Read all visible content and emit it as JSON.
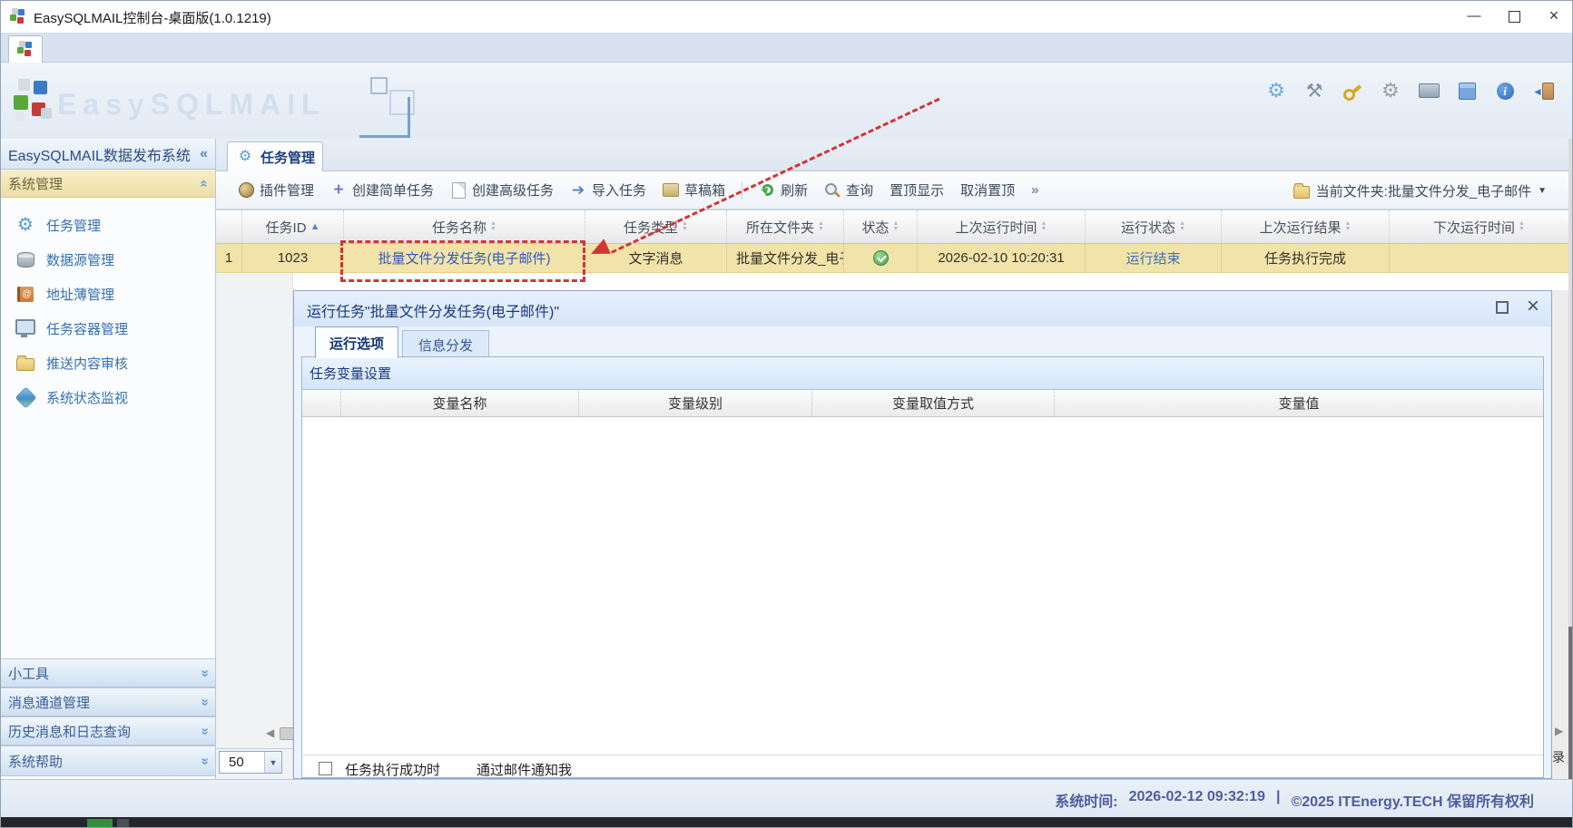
{
  "titlebar": {
    "title": "EasySQLMAIL控制台-桌面版(1.0.1219)",
    "minimize_glyph": "—",
    "close_glyph": "×"
  },
  "banner": {
    "watermark": "EasySQLMAIL"
  },
  "header_icons": [
    {
      "name": "settings-gear-icon"
    },
    {
      "name": "tools-icon"
    },
    {
      "name": "key-icon"
    },
    {
      "name": "service-gear-icon"
    },
    {
      "name": "drive-icon"
    },
    {
      "name": "cube-icon"
    },
    {
      "name": "info-icon"
    },
    {
      "name": "exit-icon"
    }
  ],
  "glyphs": {
    "collapse_left": "«",
    "chevron": "«",
    "overflow": "»",
    "dropdown": "▼",
    "sort_asc": "▲",
    "left_arrow": "◀",
    "right_arrow": "▶",
    "select_arrow": "▼",
    "exit_arrow": "◄",
    "info_i": "i",
    "gear": "⚙",
    "tools": "⚒"
  },
  "sidebar": {
    "header": "EasySQLMAIL数据发布系统",
    "section": "系统管理",
    "items": [
      {
        "label": "任务管理",
        "icon": "gear-icon"
      },
      {
        "label": "数据源管理",
        "icon": "database-icon"
      },
      {
        "label": "地址薄管理",
        "icon": "address-book-icon"
      },
      {
        "label": "任务容器管理",
        "icon": "monitor-icon"
      },
      {
        "label": "推送内容审核",
        "icon": "folder-icon"
      },
      {
        "label": "系统状态监视",
        "icon": "globe-icon"
      }
    ],
    "bottom_sections": [
      {
        "label": "小工具"
      },
      {
        "label": "消息通道管理"
      },
      {
        "label": "历史消息和日志查询"
      },
      {
        "label": "系统帮助"
      }
    ]
  },
  "main": {
    "tab_label": "任务管理",
    "toolbar": {
      "plugin": "插件管理",
      "create_simple": "创建简单任务",
      "create_advanced": "创建高级任务",
      "import_task": "导入任务",
      "draftbox": "草稿箱",
      "refresh": "刷新",
      "query": "查询",
      "pin_top": "置顶显示",
      "unpin_top": "取消置顶",
      "current_folder": "当前文件夹:批量文件分发_电子邮件"
    },
    "table": {
      "columns": [
        "任务ID",
        "任务名称",
        "任务类型",
        "所在文件夹",
        "状态",
        "上次运行时间",
        "运行状态",
        "上次运行结果",
        "下次运行时间"
      ],
      "row": {
        "num": "1",
        "task_id": "1023",
        "task_name": "批量文件分发任务(电子邮件)",
        "task_type": "文字消息",
        "folder": "批量文件分发_电子邮件",
        "status_icon": "check-green",
        "last_run_time": "2026-02-10 10:20:31",
        "run_status": "运行结束",
        "last_run_result": "任务执行完成",
        "next_run_time": ""
      }
    },
    "pager": {
      "page_size": "50",
      "record_text": "录"
    }
  },
  "dialog": {
    "title": "运行任务\"批量文件分发任务(电子邮件)\"",
    "close_glyph": "×",
    "tab_run_options": "运行选项",
    "tab_info_dispatch": "信息分发",
    "section_header": "任务变量设置",
    "columns": [
      "变量名称",
      "变量级别",
      "变量取值方式",
      "变量值"
    ],
    "notify_text_1": "任务执行成功时",
    "notify_text_2": "通过邮件通知我"
  },
  "statusbar": {
    "time_label": "系统时间:",
    "time_value": "2026-02-12 09:32:19",
    "separator": "|",
    "copyright": "©2025 ITEnergy.TECH 保留所有权利"
  },
  "colors": {
    "accent_blue": "#3470ae",
    "row_highlight": "#f2e3a8",
    "annotation_red": "#d43434",
    "link_blue": "#2e59c9",
    "status_text": "#4f5d9e"
  }
}
